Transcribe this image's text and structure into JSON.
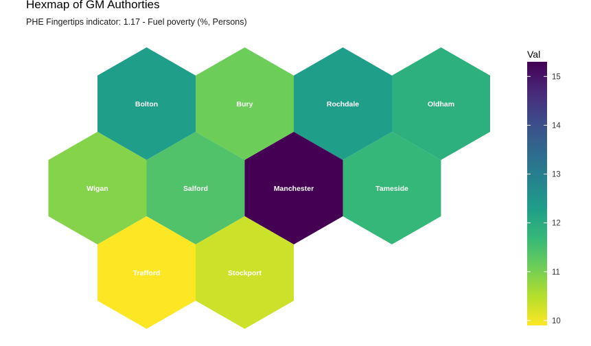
{
  "chart_data": {
    "type": "heatmap",
    "title": "Hexmap of GM Authorties",
    "subtitle": "PHE Fingertips indicator: 1.17 - Fuel poverty (%, Persons)",
    "legend": {
      "title": "Val",
      "placement": "right",
      "range": [
        9.9,
        15.3
      ],
      "ticks": [
        10,
        11,
        12,
        13,
        14,
        15
      ],
      "colors": [
        "#FDE725",
        "#B4DE2C",
        "#6DCD59",
        "#35B779",
        "#1F9E89",
        "#26828E",
        "#31688E",
        "#3E4A89",
        "#482878",
        "#440154"
      ]
    },
    "grid": false,
    "cells": [
      {
        "name": "Bolton",
        "col": 1,
        "row": 0,
        "value": 12.3
      },
      {
        "name": "Bury",
        "col": 2,
        "row": 0,
        "value": 11.1
      },
      {
        "name": "Rochdale",
        "col": 3,
        "row": 0,
        "value": 12.3
      },
      {
        "name": "Oldham",
        "col": 4,
        "row": 0,
        "value": 11.9
      },
      {
        "name": "Wigan",
        "col": 0,
        "row": 1,
        "value": 10.9
      },
      {
        "name": "Salford",
        "col": 1,
        "row": 1,
        "value": 11.4
      },
      {
        "name": "Manchester",
        "col": 2,
        "row": 1,
        "value": 15.3
      },
      {
        "name": "Tameside",
        "col": 3,
        "row": 1,
        "value": 11.7
      },
      {
        "name": "Trafford",
        "col": 1,
        "row": 2,
        "value": 9.9
      },
      {
        "name": "Stockport",
        "col": 2,
        "row": 2,
        "value": 10.3
      }
    ]
  }
}
